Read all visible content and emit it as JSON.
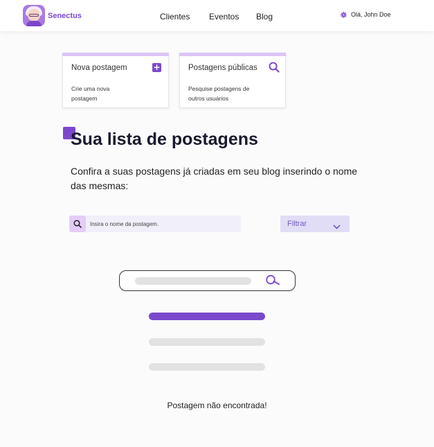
{
  "header": {
    "brand": "Senectus",
    "nav": [
      "Clientes",
      "Eventos",
      "Blog"
    ],
    "user_greeting": "Olá, John Doe"
  },
  "cards": [
    {
      "title": "Nova postagem",
      "description": "Crie uma nova postagem",
      "icon": "plus-icon"
    },
    {
      "title": "Postagens públicas",
      "description": "Pesquise  postagens de outros usuários",
      "icon": "search-icon"
    }
  ],
  "main": {
    "title": "Sua lista de postagens",
    "description": "Confira a suas postagens já criadas em seu blog inserindo o nome das mesmas:",
    "search_placeholder": "Insira o nome da postagem.",
    "filter_label": "Filtrar"
  },
  "empty_state": {
    "message": "Postagem não encontrada!"
  },
  "colors": {
    "accent": "#7b49cc",
    "card_top": "#dcc5f5",
    "search_bg": "#f1eff9",
    "filter_bg": "#e2ddf6"
  }
}
